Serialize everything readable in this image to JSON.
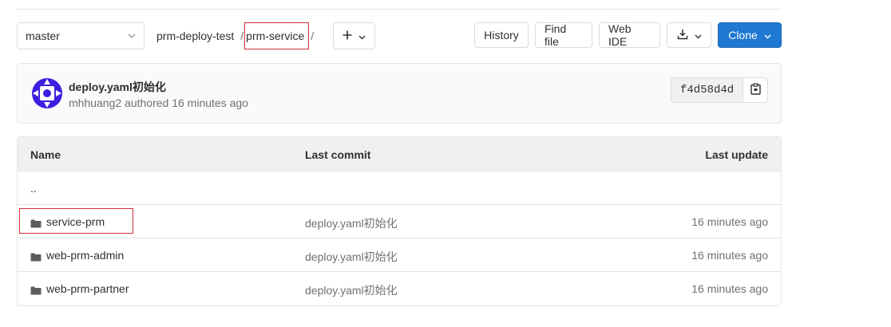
{
  "toolbar": {
    "branch": "master",
    "breadcrumb": {
      "project": "prm-deploy-test",
      "separator": "/",
      "current": "prm-service",
      "trailing_separator": "/"
    },
    "add_icon": "plus-icon",
    "buttons": {
      "history": "History",
      "find_file": "Find file",
      "web_ide": "Web IDE",
      "download_icon": "download-icon",
      "clone": "Clone"
    }
  },
  "commit": {
    "title": "deploy.yaml初始化",
    "author": "mhhuang2",
    "meta": "mhhuang2 authored 16 minutes ago",
    "sha": "f4d58d4d",
    "copy_icon": "clipboard-icon"
  },
  "tree": {
    "headers": {
      "name": "Name",
      "last_commit": "Last commit",
      "last_update": "Last update"
    },
    "parent": "..",
    "rows": [
      {
        "name": "service-prm",
        "commit": "deploy.yaml初始化",
        "updated": "16 minutes ago",
        "icon": "folder-icon"
      },
      {
        "name": "web-prm-admin",
        "commit": "deploy.yaml初始化",
        "updated": "16 minutes ago",
        "icon": "folder-icon"
      },
      {
        "name": "web-prm-partner",
        "commit": "deploy.yaml初始化",
        "updated": "16 minutes ago",
        "icon": "folder-icon"
      }
    ]
  },
  "colors": {
    "accent": "#1f78d1",
    "highlight_box": "#d0303a",
    "avatar": "#3b1ee0"
  }
}
